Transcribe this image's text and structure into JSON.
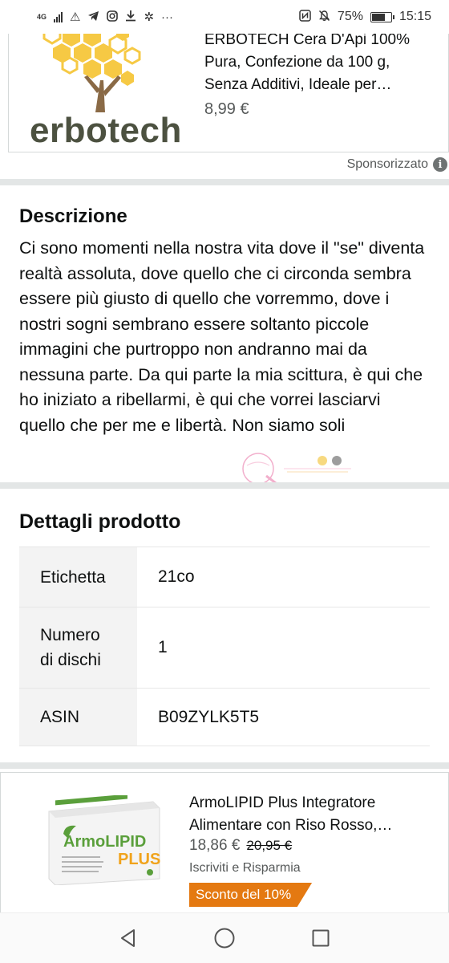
{
  "status_bar": {
    "network": "4G",
    "icons": [
      "signal-icon",
      "warning-icon",
      "telegram-icon",
      "instagram-icon",
      "download-icon",
      "bug-icon",
      "more-icon"
    ],
    "right_icons": [
      "nfc-icon",
      "mute-icon"
    ],
    "battery": "75%",
    "battery_level": 0.75,
    "time": "15:15"
  },
  "sponsored_product": {
    "logo_text": "erbotech",
    "title": "ERBOTECH Cera D'Api 100% Pura, Confezione da 100 g, Senza Additivi, Ideale per…",
    "price": "8,99 €",
    "sponsored_label": "Sponsorizzato",
    "info_icon": "i"
  },
  "description": {
    "heading": "Descrizione",
    "body": "Ci sono momenti nella nostra vita dove il \"se\" diventa realtà assoluta, dove quello che ci circonda sembra essere più giusto di quello che vorremmo, dove i nostri sogni sembrano essere soltanto piccole immagini che purtroppo non andranno mai da nessuna parte. Da qui parte la mia scittura, è qui che ho iniziato a ribellarmi, è qui che vorrei lasciarvi quello che per me e libertà. Non siamo soli"
  },
  "details": {
    "heading": "Dettagli prodotto",
    "rows": [
      {
        "label": "Etichetta",
        "value": "21co"
      },
      {
        "label": "Numero di dischi",
        "value": "1"
      },
      {
        "label": "ASIN",
        "value": "B09ZYLK5T5"
      }
    ]
  },
  "bottom_product": {
    "title": "ArmoLIPID Plus Integratore Alimentare con Riso Rosso,…",
    "price": "18,86 €",
    "old_price": "20,95 €",
    "subscribe": "Iscriviti e Risparmia",
    "badge": "Sconto del 10%",
    "box_brand": "ArmoLIPID",
    "box_plus": "PLUS",
    "badge_color": "#e47911"
  },
  "nav": {
    "back": "back-icon",
    "home": "home-icon",
    "recents": "recents-icon"
  }
}
